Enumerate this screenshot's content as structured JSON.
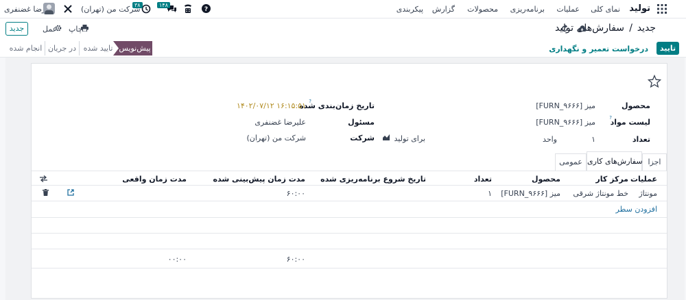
{
  "nav": {
    "app_name": "تولید",
    "menu": [
      "نمای کلی",
      "عملیات",
      "برنامه‌ریزی",
      "محصولات",
      "گزارش",
      "پیکربندی"
    ],
    "company": "شرکت من (تهران)",
    "user": "علیرضا غضنفری",
    "activity_count": "۳۸",
    "message_count": "۱۴۸"
  },
  "control": {
    "breadcrumb_parent": "سفارش‌های تولید",
    "breadcrumb_sep": "/",
    "record_title": "جدید",
    "print_label": "چاپ",
    "action_label": "عمل",
    "new_label": "جدید"
  },
  "status": {
    "confirm_label": "تایید",
    "maintenance_label": "درخواست تعمیر و نگهداری",
    "stages": [
      "پیش‌نویس",
      "تایید شده",
      "در جریان",
      "انجام شده"
    ],
    "active_stage": "پیش‌نویس"
  },
  "form": {
    "product_label": "محصول",
    "product_value": "[FURN_۹۶۶۶] میز",
    "bom_label": "لیست مواد",
    "bom_value": "[FURN_۹۶۶۶] میز",
    "bom_help": "?",
    "qty_label": "تعداد",
    "qty_value": "۱",
    "uom_value": "واحد",
    "to_produce_label": "برای تولید",
    "scheduled_label": "تاریخ زمان‌بندی شده",
    "scheduled_help": "?",
    "scheduled_value": "۱۴۰۲/۰۷/۱۲ ۱۶:۱۵:۵۱",
    "responsible_label": "مسئول",
    "responsible_value": "علیرضا غضنفری",
    "company_label": "شرکت",
    "company_value": "شرکت من (تهران)"
  },
  "tabs": [
    "اجزا",
    "سفارش‌های کاری",
    "عمومی"
  ],
  "active_tab": "سفارش‌های کاری",
  "table": {
    "columns": [
      "عملیات",
      "مرکز کار",
      "محصول",
      "تعداد",
      "تاریخ شروع برنامه‌ریزی شده",
      "مدت زمان پیش‌بینی شده",
      "مدت زمان واقعی"
    ],
    "rows": [
      {
        "operation": "مونتاژ",
        "workcenter": "خط مونتاژ شرقی",
        "product": "[FURN_۹۶۶۶] میز",
        "qty": "۱",
        "planned_start": "",
        "expected_duration": "۶۰:۰۰",
        "real_duration": ""
      }
    ],
    "add_line": "افزودن سطر",
    "total_expected": "۶۰:۰۰",
    "total_real": "۰۰:۰۰"
  },
  "colors": {
    "brand": "#714b67",
    "accent": "#017e84",
    "link": "#1f6f9f",
    "date": "#b08a1e"
  }
}
